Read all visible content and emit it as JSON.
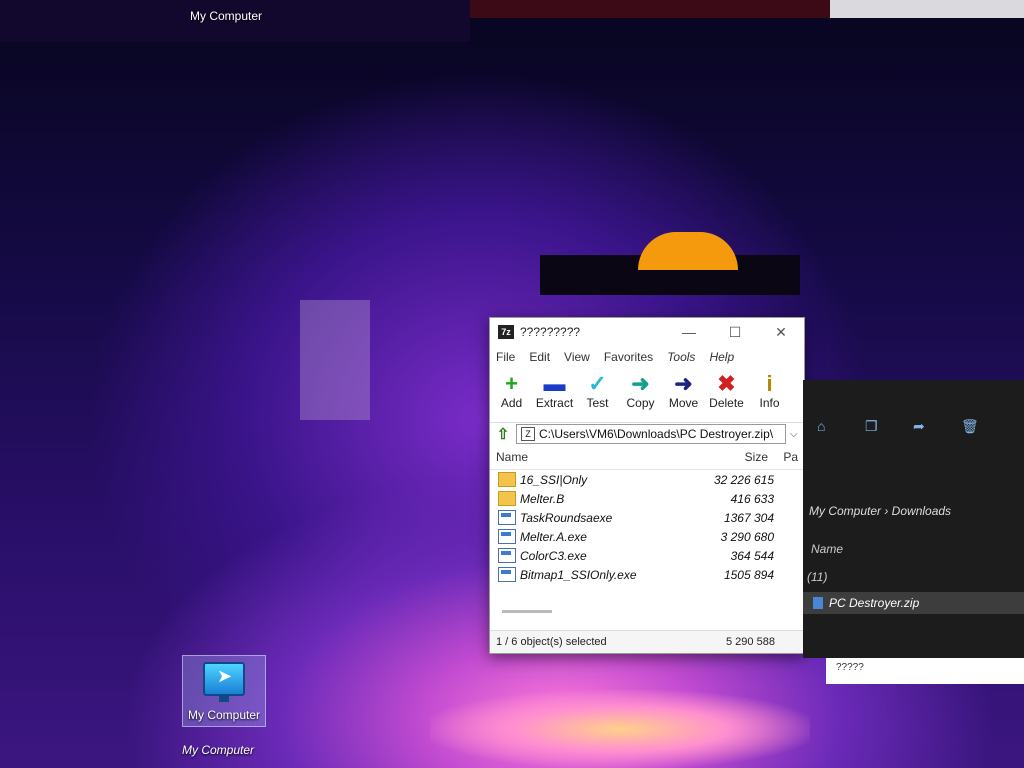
{
  "desktop": {
    "top_label": "My Computer",
    "icon_label": "My Computer",
    "bottom_label": "My Computer"
  },
  "zip_window": {
    "title": "?????????",
    "menu": [
      "File",
      "Edit",
      "View",
      "Favorites",
      "Tools",
      "Help"
    ],
    "toolbar": [
      {
        "label": "Add",
        "icon": "add-icon",
        "glyph": "+",
        "color": "#18a818"
      },
      {
        "label": "Extract",
        "icon": "extract-icon",
        "glyph": "▬",
        "color": "#1a3cc8"
      },
      {
        "label": "Test",
        "icon": "test-icon",
        "glyph": "✓",
        "color": "#2bb7d6"
      },
      {
        "label": "Copy",
        "icon": "copy-icon",
        "glyph": "➜",
        "color": "#16a08a"
      },
      {
        "label": "Move",
        "icon": "move-icon",
        "glyph": "➜",
        "color": "#1a237e"
      },
      {
        "label": "Delete",
        "icon": "delete-icon",
        "glyph": "✖",
        "color": "#d21f1f"
      },
      {
        "label": "Info",
        "icon": "info-icon",
        "glyph": "i",
        "color": "#b08a00"
      }
    ],
    "address": "C:\\Users\\VM6\\Downloads\\PC Destroyer.zip\\",
    "columns": {
      "name": "Name",
      "size": "Size",
      "packed": "Pa"
    },
    "files": [
      {
        "name": "16_SSI|Only",
        "size": "32 226 615",
        "type": "folder"
      },
      {
        "name": "Melter.B",
        "size": "416 633",
        "type": "folder"
      },
      {
        "name": "TaskRoundsaexe",
        "size": "1367 304",
        "type": "exe"
      },
      {
        "name": "Melter.A.exe",
        "size": "3 290 680",
        "type": "exe"
      },
      {
        "name": "ColorC3.exe",
        "size": "364 544",
        "type": "exe"
      },
      {
        "name": "Bitmap1_SSIOnly.exe",
        "size": "1505 894",
        "type": "exe"
      }
    ],
    "status_left": "1 / 6 object(s) selected",
    "status_right": "5 290 588"
  },
  "explorer": {
    "breadcrumb": "My Computer  ›  Downloads",
    "column": "Name",
    "row1": "(11)",
    "selected_file": "PC Destroyer.zip",
    "status": "?????"
  }
}
